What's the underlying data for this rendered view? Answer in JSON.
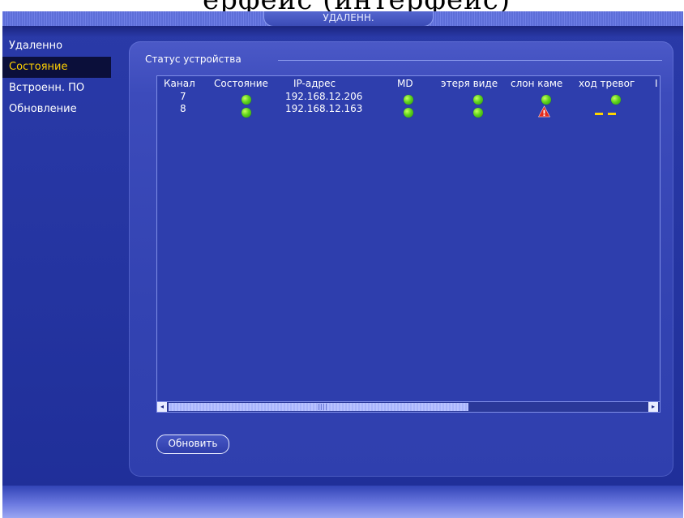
{
  "caption_fragment": "ерфейс (интерфейс)",
  "window": {
    "title": "УДАЛЕНН."
  },
  "sidebar": {
    "items": [
      {
        "label": "Удаленно",
        "active": false
      },
      {
        "label": "Состояние",
        "active": true
      },
      {
        "label": "Встроенн. ПО",
        "active": false
      },
      {
        "label": "Обновление",
        "active": false
      }
    ]
  },
  "panel": {
    "title": "Статус устройства"
  },
  "table": {
    "columns": [
      "Канал",
      "Состояние",
      "IP-адрес",
      "MD",
      "этеря виде",
      "слон каме",
      "ход тревог",
      "I"
    ],
    "rows": [
      {
        "channel": "7",
        "state": "ok",
        "ip": "192.168.12.206",
        "md": "ok",
        "video_loss": "ok",
        "camera_tamper": "ok",
        "alarm_in": "ok"
      },
      {
        "channel": "8",
        "state": "ok",
        "ip": "192.168.12.163",
        "md": "ok",
        "video_loss": "ok",
        "camera_tamper": "warning",
        "alarm_in": "none"
      }
    ],
    "status_icons": {
      "ok": "green-dot-icon",
      "warning": "warning-triangle-icon",
      "none": "dash-indicator-icon"
    }
  },
  "scroll": {
    "left_arrow": "◂",
    "right_arrow": "▸",
    "position_fraction": 0.0
  },
  "buttons": {
    "refresh": "Обновить"
  },
  "colors": {
    "background": "#2434a0",
    "panel": "#3a49b8",
    "active_item_text": "#ffd000",
    "status_ok": "#5fd31c",
    "warning": "#e02a1c",
    "none_dash": "#ffd400"
  }
}
